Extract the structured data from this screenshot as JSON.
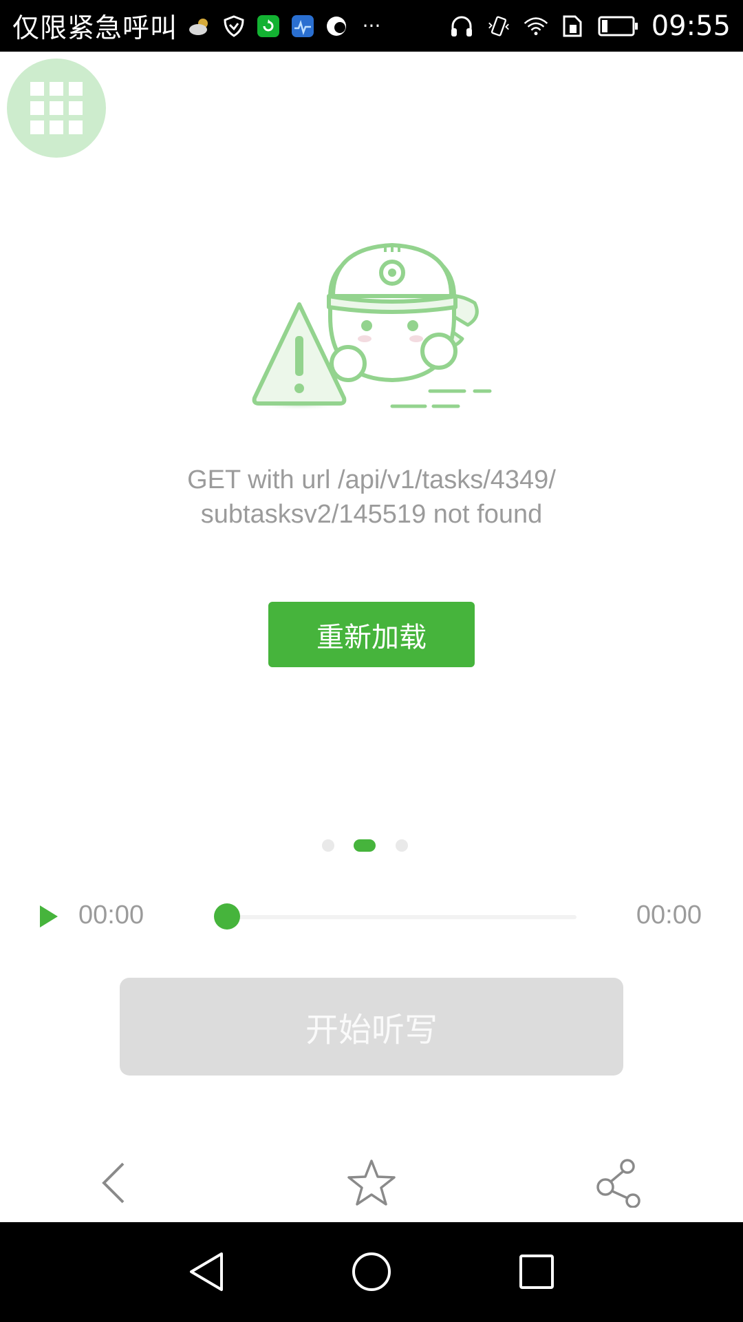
{
  "status_bar": {
    "carrier_text": "仅限紧急呼叫",
    "time": "09:55",
    "icons": [
      "weather-icon",
      "shield-icon",
      "refresh-app-icon",
      "health-app-icon",
      "browser-icon",
      "more-dots-icon",
      "headphones-icon",
      "vibrate-icon",
      "wifi-icon",
      "sim-icon",
      "battery-icon"
    ],
    "more": "···"
  },
  "grid_button": {
    "icon": "grid-icon"
  },
  "error": {
    "illustration": "robot-warning-illustration",
    "message_line1": "GET with url /api/v1/tasks/4349/",
    "message_line2": "subtasksv2/145519 not found",
    "reload_label": "重新加载"
  },
  "pager": {
    "count": 3,
    "active_index": 1
  },
  "player": {
    "current_time": "00:00",
    "total_time": "00:00",
    "progress": 0
  },
  "start_button": {
    "label": "开始听写"
  },
  "toolbar": {
    "back_icon": "chevron-left-icon",
    "favorite_icon": "star-icon",
    "share_icon": "share-icon"
  },
  "colors": {
    "accent": "#46b43c",
    "muted_text": "#9b9b9b",
    "disabled_bg": "#dcdcdc",
    "bubble": "#cdeccd"
  }
}
